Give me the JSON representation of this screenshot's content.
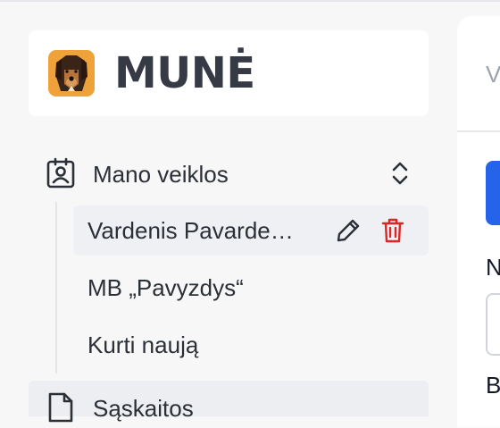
{
  "brand": {
    "name": "MUNĖ",
    "logo": "dog-mascot-logo"
  },
  "sidebar": {
    "group": {
      "label": "Mano veiklos",
      "icon": "id-badge-icon",
      "toggle_icon": "chevron-up-down-icon"
    },
    "items": [
      {
        "label": "Vardenis Pavarde…",
        "active": true,
        "actions": [
          "pencil-icon",
          "trash-icon"
        ]
      },
      {
        "label": "MB „Pavyzdys“",
        "active": false
      },
      {
        "label": "Kurti naują",
        "active": false
      }
    ],
    "next_group": {
      "label": "Sąskaitos",
      "icon": "document-icon"
    }
  },
  "main": {
    "tab_text": "V",
    "field_label": "N",
    "field_label_2": "B",
    "field_value": ""
  },
  "colors": {
    "accent": "#2563eb",
    "danger": "#dc2626",
    "active_bg": "#eef0f4"
  }
}
